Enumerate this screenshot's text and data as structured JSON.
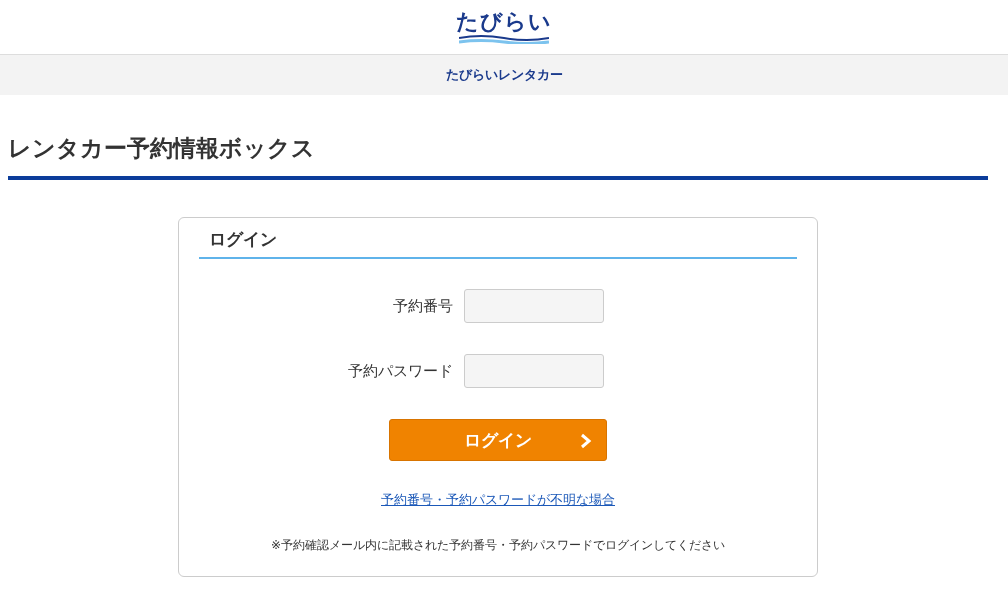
{
  "header": {
    "logo": "たびらい",
    "service": "たびらいレンタカー"
  },
  "page_title": "レンタカー予約情報ボックス",
  "login": {
    "title": "ログイン",
    "fields": [
      {
        "label": "予約番号"
      },
      {
        "label": "予約パスワード"
      }
    ],
    "button": "ログイン",
    "help_link": "予約番号・予約パスワードが不明な場合",
    "note": "※予約確認メール内に記載された予約番号・予約パスワードでログインしてください"
  }
}
